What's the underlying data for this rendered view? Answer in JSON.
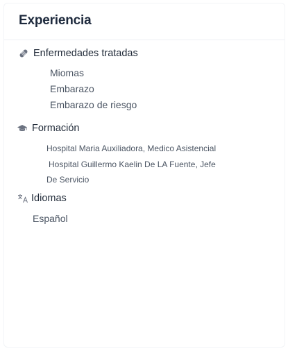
{
  "card": {
    "title": "Experiencia"
  },
  "diseases": {
    "heading": "Enfermedades tratadas",
    "icon": "bandage-icon",
    "items": [
      "Miomas",
      "Embarazo",
      "Embarazo de riesgo"
    ]
  },
  "education": {
    "heading": "Formación",
    "icon": "graduation-cap-icon",
    "lines": [
      "Hospital Maria Auxiliadora, Medico Asistencial",
      "Hospital Guillermo Kaelin De LA Fuente, Jefe",
      "De Servicio"
    ]
  },
  "languages": {
    "heading": "Idiomas",
    "icon": "translate-icon",
    "items": [
      "Español"
    ]
  },
  "colors": {
    "heading_text": "#1e2a3d",
    "body_text": "#4b5563",
    "icon": "#6b7280",
    "divider": "#eef0f3"
  }
}
